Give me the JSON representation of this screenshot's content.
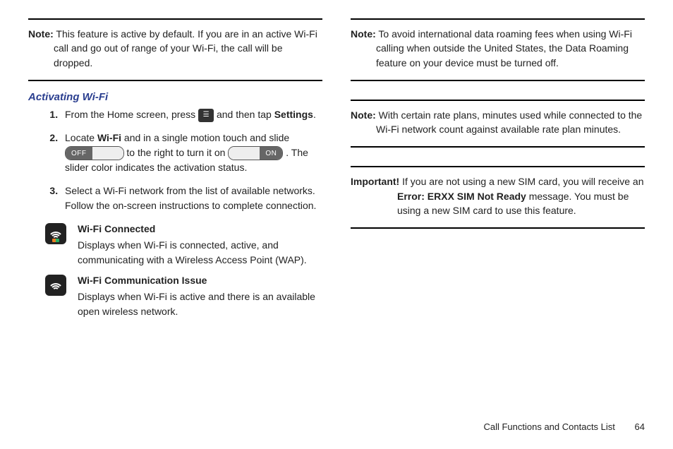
{
  "col1": {
    "note1": {
      "label": "Note:",
      "text": "This feature is active by default. If you are in an active Wi-Fi call and go out of range of your Wi-Fi, the call will be dropped."
    },
    "heading": "Activating Wi-Fi",
    "step1_a": "From the Home screen, press ",
    "step1_b": " and then tap ",
    "step1_bold": "Settings",
    "step1_c": ".",
    "step2_a": "Locate ",
    "step2_wifi": "Wi-Fi",
    "step2_b": " and in a single motion touch and slide ",
    "toggle_off": "OFF",
    "step2_c": " to the right to turn it on ",
    "toggle_on": "ON",
    "step2_d": ". The slider color indicates the activation status.",
    "step3": "Select a Wi-Fi network from the list of available networks. Follow the on-screen instructions to complete connection.",
    "status1": {
      "title": "Wi-Fi Connected",
      "text": "Displays when Wi-Fi is connected, active, and communicating with a Wireless Access Point (WAP)."
    },
    "status2": {
      "title": "Wi-Fi Communication Issue",
      "text": "Displays when Wi-Fi is active and there is an available open wireless network."
    }
  },
  "col2": {
    "note1": {
      "label": "Note:",
      "text": "To avoid international data roaming fees when using Wi-Fi calling when outside the United States, the Data Roaming feature on your device must be turned off."
    },
    "note2": {
      "label": "Note:",
      "text": "With certain rate plans, minutes used while connected to the Wi-Fi network count against available rate plan minutes."
    },
    "important": {
      "label": "Important!",
      "text_a": "If you are not using a new SIM card, you will receive an ",
      "err": "Error: ERXX SIM Not Ready",
      "text_b": " message. You must be using a new SIM card to use this feature."
    }
  },
  "footer": {
    "section": "Call Functions and Contacts List",
    "page": "64"
  }
}
